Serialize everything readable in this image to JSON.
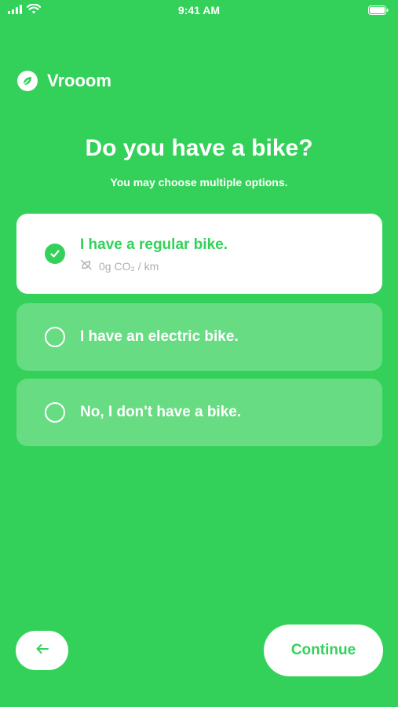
{
  "status_bar": {
    "time": "9:41 AM"
  },
  "brand": {
    "name": "Vrooom",
    "logo_icon": "leaf-icon"
  },
  "header": {
    "title": "Do you have a bike?",
    "subtitle": "You may choose multiple options."
  },
  "options": [
    {
      "label": "I have a regular bike.",
      "selected": true,
      "meta": "0g CO₂ / km",
      "meta_icon": "leaf-off-icon"
    },
    {
      "label": "I have an electric bike.",
      "selected": false
    },
    {
      "label": "No, I don't have a bike.",
      "selected": false
    }
  ],
  "footer": {
    "back_icon": "arrow-left-icon",
    "continue_label": "Continue"
  },
  "colors": {
    "background": "#34D15A",
    "card_selected": "#FFFFFF",
    "card_unselected": "rgba(255,255,255,0.25)",
    "meta_text": "#AFAFAF"
  }
}
